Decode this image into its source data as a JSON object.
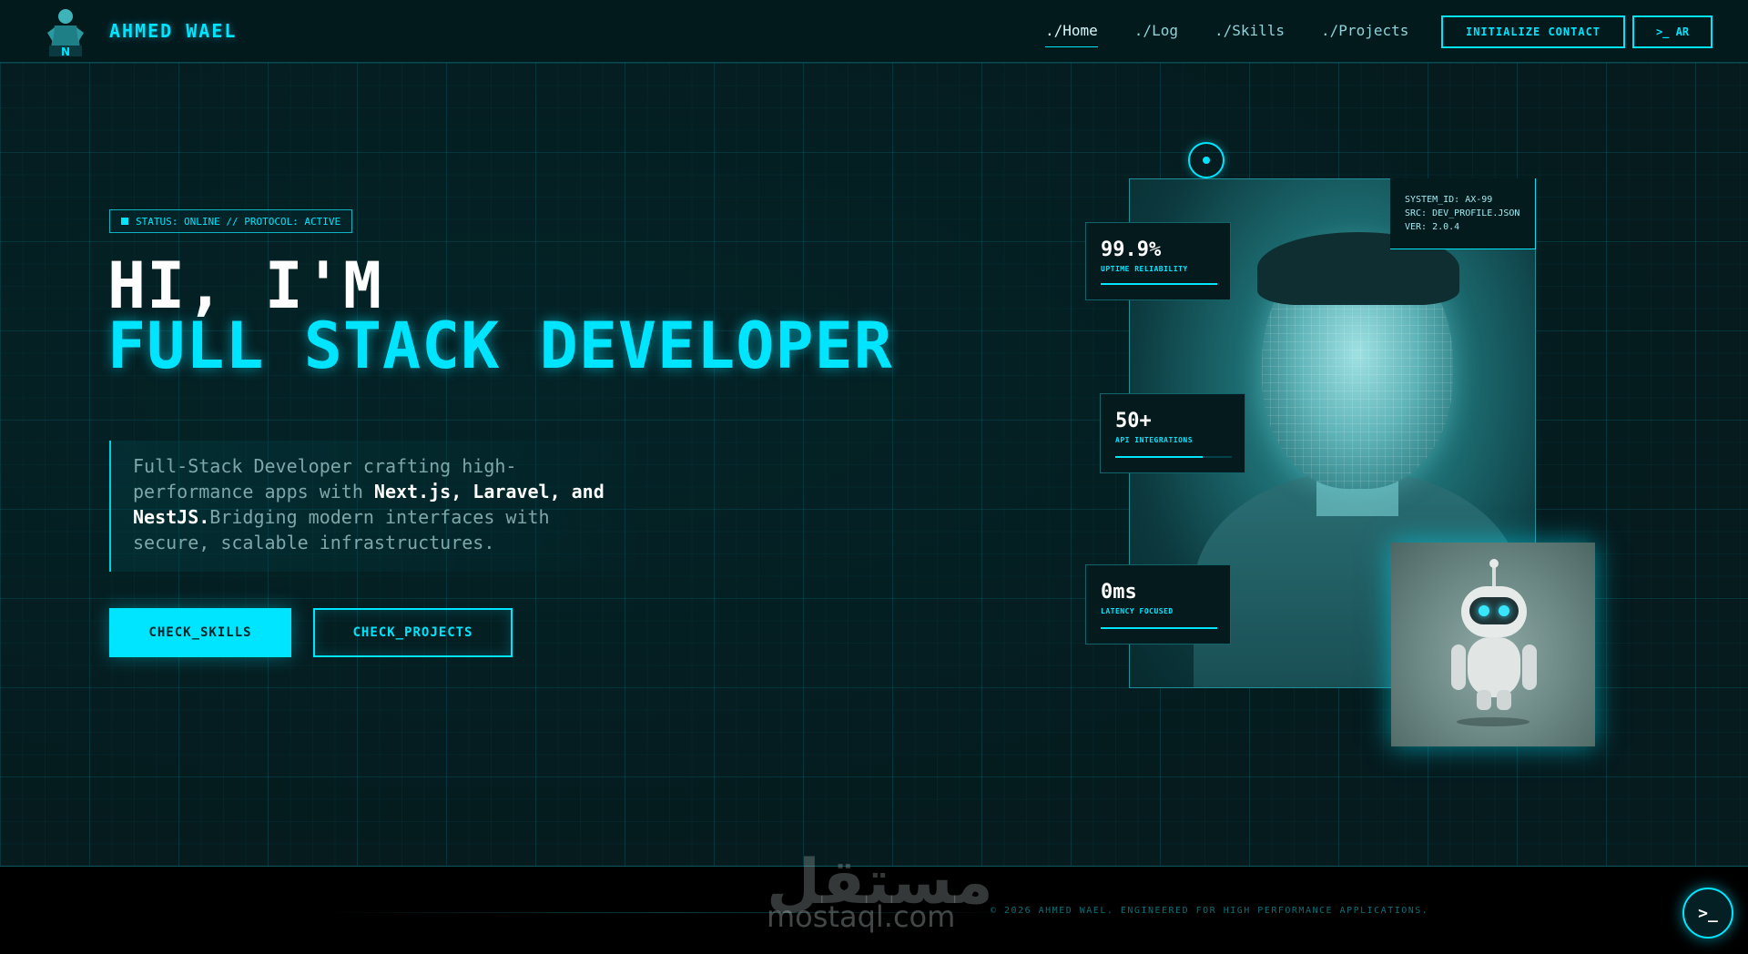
{
  "header": {
    "brand": "AHMED WAEL",
    "nav": [
      "./Home",
      "./Log",
      "./Skills",
      "./Projects"
    ],
    "active_nav": "./Home",
    "contact_label": "INITIALIZE CONTACT",
    "lang_label": ">_ AR"
  },
  "hero": {
    "status": "STATUS: ONLINE // PROTOCOL: ACTIVE",
    "greeting": "HI, I'M",
    "role": "FULL STACK DEVELOPER",
    "desc_part1": "Full-Stack Developer crafting high-performance apps with ",
    "desc_bold1": "Next.js, Laravel, and",
    "desc_bold2": "NestJS.",
    "desc_part2": "Bridging modern interfaces with secure, scalable infrastructures.",
    "btn_skills": "CHECK_SKILLS",
    "btn_projects": "CHECK_PROJECTS"
  },
  "profile": {
    "system_id": "SYSTEM_ID: AX-99",
    "src": "SRC: DEV_PROFILE.JSON",
    "ver": "VER: 2.0.4",
    "stats": [
      {
        "value": "99.9%",
        "label": "UPTIME RELIABILITY",
        "fill": 1.0
      },
      {
        "value": "50+",
        "label": "API INTEGRATIONS",
        "fill": 0.75
      },
      {
        "value": "0ms",
        "label": "LATENCY FOCUSED",
        "fill": 1.0
      }
    ]
  },
  "footer": {
    "copyright": "© 2026 AHMED WAEL. ENGINEERED FOR HIGH PERFORMANCE APPLICATIONS.",
    "watermark_ar": "مستقل",
    "watermark_en": "mostaql.com",
    "terminal_icon": ">_"
  },
  "colors": {
    "accent": "#00e5ff",
    "background": "#051b1e",
    "footer": "#000000"
  }
}
